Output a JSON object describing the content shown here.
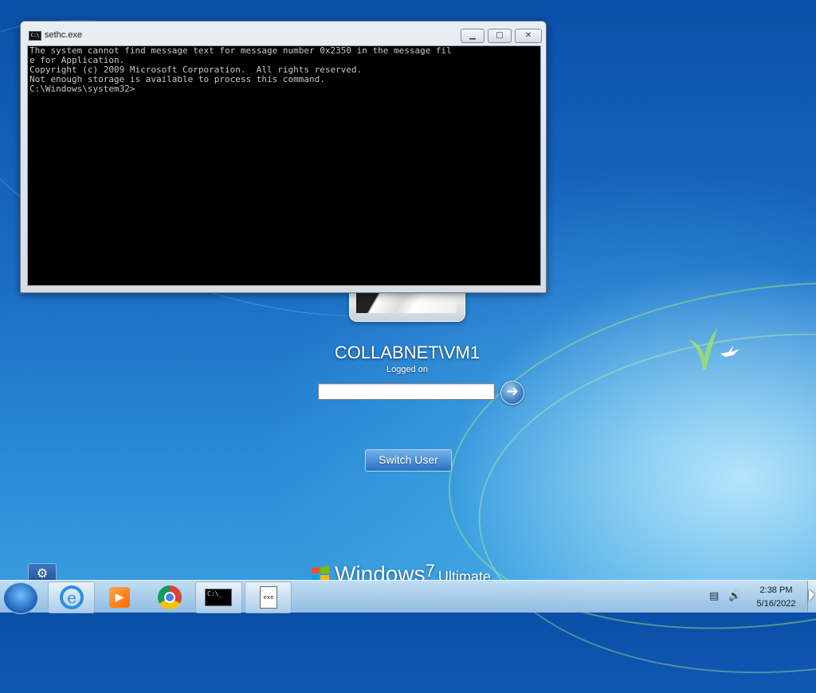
{
  "console_window": {
    "title": "sethc.exe",
    "icon": "console-app-icon",
    "buttons": {
      "minimize": "▁",
      "maximize": "□",
      "close": "✕"
    },
    "lines": [
      "The system cannot find message text for message number 0x2350 in the message fil",
      "e for Application.",
      "",
      "Copyright (c) 2009 Microsoft Corporation.  All rights reserved.",
      "Not enough storage is available to process this command.",
      "",
      "C:\\Windows\\system32>"
    ]
  },
  "logon": {
    "username": "COLLABNET\\VM1",
    "status": "Logged on",
    "password_value": "",
    "submit_icon": "arrow-right-icon",
    "submit_glyph": "➔",
    "switch_user_label": "Switch User",
    "ease_of_access_icon": "ease-of-access-icon",
    "ease_glyph": "⚙"
  },
  "branding": {
    "product": "Windows",
    "version": "7",
    "edition": "Ultimate"
  },
  "taskbar": {
    "start_icon": "windows-start-orb-icon",
    "pinned": [
      {
        "name": "internet-explorer",
        "icon": "ie-icon",
        "glyph": "e"
      },
      {
        "name": "windows-media-player",
        "icon": "media-player-icon",
        "glyph": "▶"
      },
      {
        "name": "google-chrome",
        "icon": "chrome-icon",
        "glyph": ""
      },
      {
        "name": "command-prompt",
        "icon": "cmd-icon",
        "glyph": "C:\\_"
      },
      {
        "name": "document",
        "icon": "document-icon",
        "glyph": "exe"
      }
    ],
    "tray": {
      "network_icon": "network-icon",
      "volume_icon": "volume-icon"
    },
    "clock": {
      "time": "2:38 PM",
      "date": "5/16/2022"
    }
  }
}
